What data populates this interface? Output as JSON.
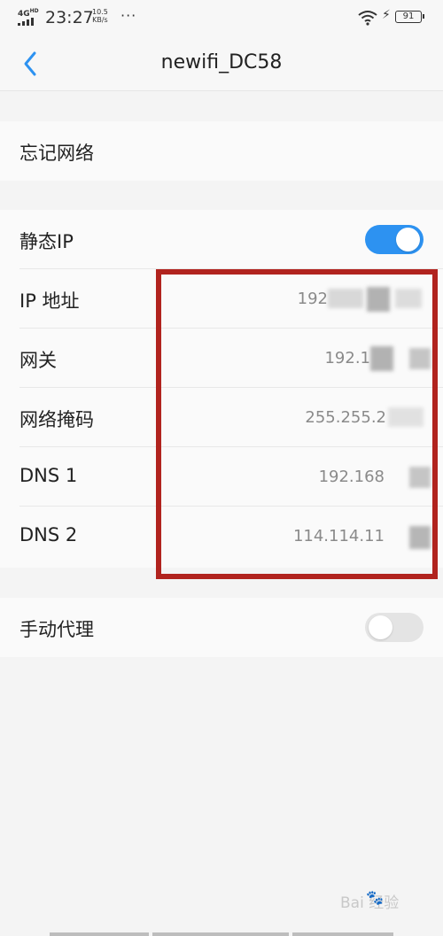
{
  "status_bar": {
    "network": "4G",
    "network_sup": "HD",
    "time": "23:27",
    "speed_value": "10.5",
    "speed_unit": "KB/s",
    "more": "···",
    "battery": "91",
    "icons": [
      "signal-icon",
      "wifi-icon",
      "charging-icon",
      "battery-icon"
    ]
  },
  "nav": {
    "title": "newifi_DC58",
    "back_icon": "chevron-left-icon"
  },
  "forget_network": {
    "label": "忘记网络"
  },
  "static_ip": {
    "label": "静态IP",
    "enabled": true
  },
  "fields": [
    {
      "label": "IP 地址",
      "value": "192"
    },
    {
      "label": "网关",
      "value": "192.1"
    },
    {
      "label": "网络掩码",
      "value": "255.255.2"
    },
    {
      "label": "DNS 1",
      "value": "192.168"
    },
    {
      "label": "DNS 2",
      "value": "114.114.11"
    }
  ],
  "manual_proxy": {
    "label": "手动代理",
    "enabled": false
  },
  "watermark": {
    "text": "Bai  经验"
  },
  "colors": {
    "accent": "#2d92f1",
    "highlight": "#b1231e",
    "background": "#f4f4f4",
    "row_background": "#fafafa"
  }
}
